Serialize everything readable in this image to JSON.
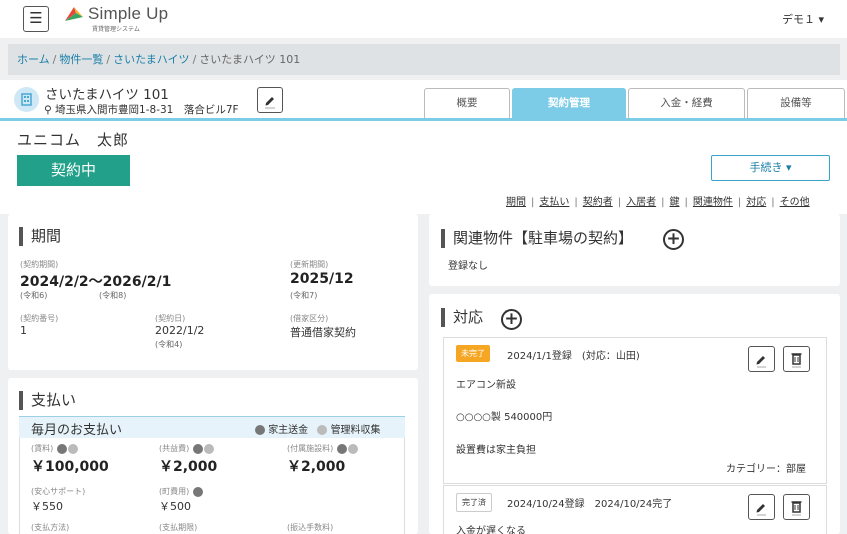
{
  "app": {
    "logo_name": "Simple Up",
    "logo_sub": "賃貸管理システム",
    "user": "デモ１ ▾"
  },
  "breadcrumb": {
    "home": "ホーム",
    "sep": "/",
    "list": "物件一覧",
    "building": "さいたまハイツ",
    "current": "さいたまハイツ 101"
  },
  "property": {
    "name": "さいたまハイツ 101",
    "address": "埼玉県入間市豊岡1-8-31　落合ビル7F"
  },
  "tabs": [
    {
      "label": "概要"
    },
    {
      "label": "契約管理"
    },
    {
      "label": "入金・経費"
    },
    {
      "label": "設備等"
    }
  ],
  "tenant": {
    "name": "ユニコム　太郎",
    "status": "契約中"
  },
  "procedure_button": "手続き ▾",
  "section_links": [
    "期間",
    "支払い",
    "契約者",
    "入居者",
    "鍵",
    "関連物件",
    "対応",
    "その他"
  ],
  "period": {
    "title": "期間",
    "contract_period_label": "(契約期間)",
    "contract_period": "2024/2/2〜2026/2/1",
    "start_era": "(令和6)",
    "end_era": "(令和8)",
    "renewal_label": "(更新期間)",
    "renewal": "2025/12",
    "renewal_era": "(令和7)",
    "number_label": "(契約番号)",
    "number": "1",
    "date_label": "(契約日)",
    "date": "2022/1/2",
    "date_era": "(令和4)",
    "type_label": "(借家区分)",
    "type": "普通借家契約"
  },
  "payment": {
    "title": "支払い",
    "monthly": "毎月のお支払い",
    "legend_owner": "家主送金",
    "legend_fee": "管理料収集",
    "rent_label": "(賃料)",
    "rent": "￥100,000",
    "common_label": "(共益費)",
    "common": "￥2,000",
    "facility_label": "(付属施設料)",
    "facility": "￥2,000",
    "support_label": "(安心サポート)",
    "support": "￥550",
    "parking_label": "(町費用)",
    "parking": "￥500",
    "method_label": "(支払方法)",
    "due_label": "(支払期限)",
    "transfer_label": "(振込手数料)"
  },
  "related": {
    "title": "関連物件【駐車場の契約】",
    "none": "登録なし"
  },
  "responses": {
    "title": "対応",
    "items": [
      {
        "badge": "未完了",
        "date": "2024/1/1登録　(対応：山田)",
        "line1": "エアコン新設",
        "line2": "○○○○製 540000円",
        "line3": "設置費は家主負担",
        "category": "カテゴリー：部屋"
      },
      {
        "badge": "完了済",
        "date": "2024/10/24登録　2024/10/24完了",
        "line1": "入金が遅くなる"
      }
    ]
  }
}
